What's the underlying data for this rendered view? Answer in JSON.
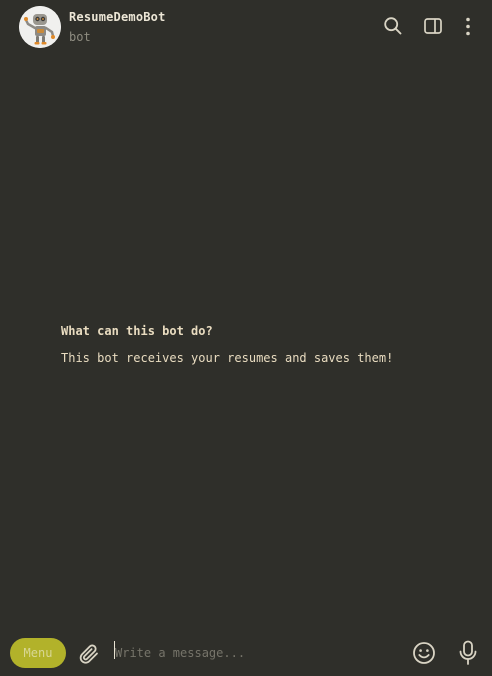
{
  "header": {
    "bot_name": "ResumeDemoBot",
    "bot_status": "bot",
    "icons": [
      "search-icon",
      "sidebar-toggle-icon",
      "more-vertical-icon"
    ]
  },
  "intro": {
    "title": "What can this bot do?",
    "description": "This bot receives your resumes and saves them!"
  },
  "composer": {
    "menu_label": "Menu",
    "placeholder": "Write a message...",
    "value": "",
    "icons": [
      "attach-icon",
      "emoji-icon",
      "microphone-icon"
    ]
  },
  "colors": {
    "background": "#2f2f2a",
    "text": "#e9dcc0",
    "muted": "#8e8c80",
    "accent": "#b2b22a",
    "icon": "#d9d4c4"
  }
}
